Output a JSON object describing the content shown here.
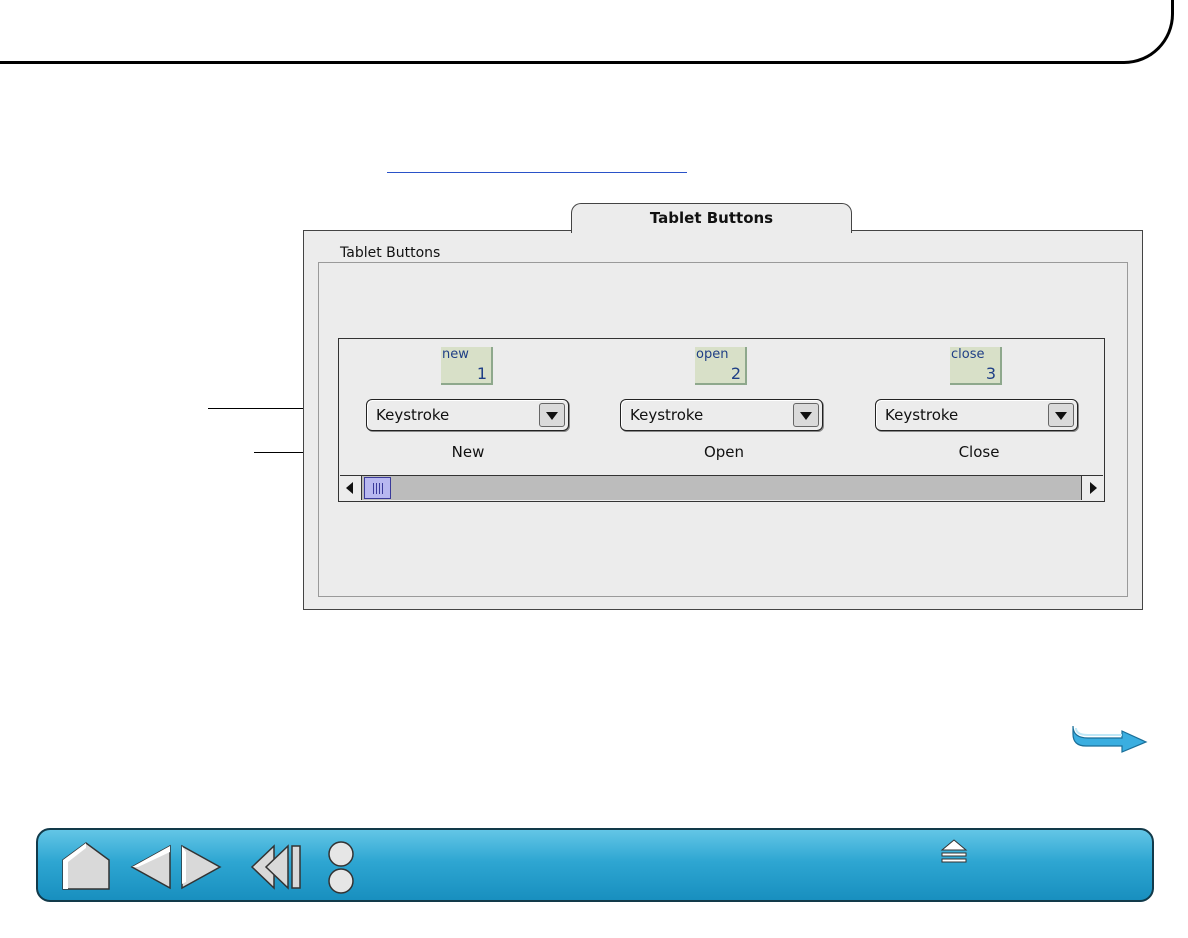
{
  "dialog": {
    "tab_label": "Tablet Buttons",
    "group_label": "Tablet Buttons",
    "buttons": [
      {
        "name": "new",
        "number": "1",
        "function": "Keystroke",
        "action_label": "New"
      },
      {
        "name": "open",
        "number": "2",
        "function": "Keystroke",
        "action_label": "Open"
      },
      {
        "name": "close",
        "number": "3",
        "function": "Keystroke",
        "action_label": "Close"
      }
    ]
  },
  "icons": {
    "next_page": "next-page-arrow-icon",
    "home": "home-icon",
    "previous": "previous-page-icon",
    "next": "next-page-icon",
    "back": "back-icon",
    "index": "index-icon",
    "eject": "eject-icon"
  },
  "colors": {
    "navbar": "#2ea6d2",
    "arrow": "#3aaee0",
    "link": "#2a52c8"
  }
}
